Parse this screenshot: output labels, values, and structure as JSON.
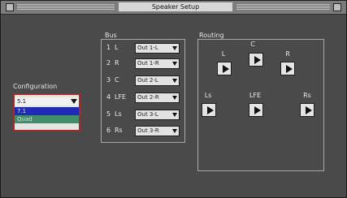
{
  "window": {
    "title": "Speaker Setup"
  },
  "config": {
    "label": "Configuration",
    "items": [
      "5.1",
      "7.1",
      "Quad"
    ],
    "selected_index": 0
  },
  "channels": {
    "label": "Bus",
    "rows": [
      {
        "num": "1",
        "name": "L",
        "assignment": "Out 1-L"
      },
      {
        "num": "2",
        "name": "R",
        "assignment": "Out 1-R"
      },
      {
        "num": "3",
        "name": "C",
        "assignment": "Out 2-L"
      },
      {
        "num": "4",
        "name": "LFE",
        "assignment": "Out 2-R"
      },
      {
        "num": "5",
        "name": "Ls",
        "assignment": "Out 3-L"
      },
      {
        "num": "6",
        "name": "Rs",
        "assignment": "Out 3-R"
      }
    ]
  },
  "routing": {
    "label": "Routing",
    "speakers": [
      {
        "name": "L"
      },
      {
        "name": "C"
      },
      {
        "name": "R"
      },
      {
        "name": "Ls"
      },
      {
        "name": "LFE"
      },
      {
        "name": "Rs"
      }
    ]
  },
  "colors": {
    "window_bg": "#4a4a4a",
    "list_border": "#a32b2b",
    "selection": "#1f2bb5"
  }
}
